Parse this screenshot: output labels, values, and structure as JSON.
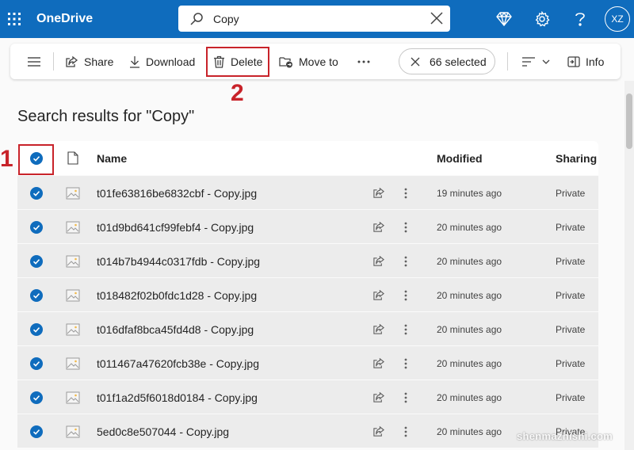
{
  "header": {
    "brand": "OneDrive",
    "search_value": "Copy",
    "avatar_initials": "XZ",
    "color": "#0f6cbd"
  },
  "toolbar": {
    "share_label": "Share",
    "download_label": "Download",
    "delete_label": "Delete",
    "move_label": "Move to",
    "selected_label": "66 selected",
    "info_label": "Info"
  },
  "annotations": {
    "step1": "1",
    "step2": "2",
    "color": "#c8232a"
  },
  "results": {
    "title": "Search results for \"Copy\"",
    "columns": {
      "name": "Name",
      "modified": "Modified",
      "sharing": "Sharing"
    },
    "rows": [
      {
        "name": "t01fe63816be6832cbf - Copy.jpg",
        "modified": "19 minutes ago",
        "sharing": "Private"
      },
      {
        "name": "t01d9bd641cf99febf4 - Copy.jpg",
        "modified": "20 minutes ago",
        "sharing": "Private"
      },
      {
        "name": "t014b7b4944c0317fdb - Copy.jpg",
        "modified": "20 minutes ago",
        "sharing": "Private"
      },
      {
        "name": "t018482f02b0fdc1d28 - Copy.jpg",
        "modified": "20 minutes ago",
        "sharing": "Private"
      },
      {
        "name": "t016dfaf8bca45fd4d8 - Copy.jpg",
        "modified": "20 minutes ago",
        "sharing": "Private"
      },
      {
        "name": "t011467a47620fcb38e - Copy.jpg",
        "modified": "20 minutes ago",
        "sharing": "Private"
      },
      {
        "name": "t01f1a2d5f6018d0184 - Copy.jpg",
        "modified": "20 minutes ago",
        "sharing": "Private"
      },
      {
        "name": "5ed0c8e507044 - Copy.jpg",
        "modified": "20 minutes ago",
        "sharing": "Private"
      }
    ]
  },
  "watermark": "shenmazhishi.com"
}
